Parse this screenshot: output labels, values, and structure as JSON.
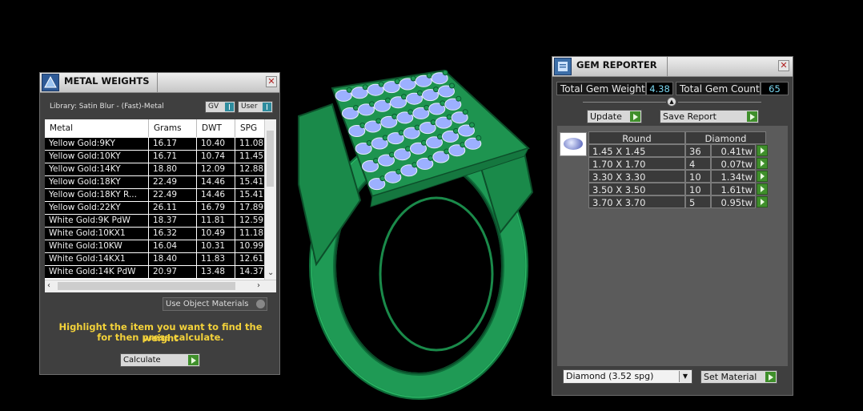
{
  "metal_weights": {
    "title": "METAL WEIGHTS",
    "library_label": "Library: Satin Blur - (Fast)-Metal",
    "toggles": [
      "GV",
      "User"
    ],
    "columns": [
      "Metal",
      "Grams",
      "DWT",
      "SPG"
    ],
    "rows": [
      [
        "Yellow Gold:9KY",
        "16.17",
        "10.40",
        "11.08"
      ],
      [
        "Yellow Gold:10KY",
        "16.71",
        "10.74",
        "11.45"
      ],
      [
        "Yellow Gold:14KY",
        "18.80",
        "12.09",
        "12.88"
      ],
      [
        "Yellow Gold:18KY",
        "22.49",
        "14.46",
        "15.41"
      ],
      [
        "Yellow Gold:18KY R...",
        "22.49",
        "14.46",
        "15.41"
      ],
      [
        "Yellow Gold:22KY",
        "26.11",
        "16.79",
        "17.89"
      ],
      [
        "White Gold:9K PdW",
        "18.37",
        "11.81",
        "12.59"
      ],
      [
        "White Gold:10KX1",
        "16.32",
        "10.49",
        "11.18"
      ],
      [
        "White Gold:10KW",
        "16.04",
        "10.31",
        "10.99"
      ],
      [
        "White Gold:14KX1",
        "18.40",
        "11.83",
        "12.61"
      ],
      [
        "White Gold:14K PdW",
        "20.97",
        "13.48",
        "14.37"
      ]
    ],
    "use_object_materials": "Use Object Materials",
    "hint_line1": "Highlight the item you want to find the weight",
    "hint_line2": "for then press calculate.",
    "calculate_label": "Calculate"
  },
  "gem_reporter": {
    "title": "GEM REPORTER",
    "total_weight_label": "Total Gem Weight",
    "total_weight_value": "4.38",
    "total_count_label": "Total Gem Count",
    "total_count_value": "65",
    "update_label": "Update",
    "save_report_label": "Save Report",
    "shape_header": "Round",
    "material_header": "Diamond",
    "gems": [
      [
        "1.45 X 1.45",
        "36",
        "0.41tw"
      ],
      [
        "1.70 X 1.70",
        "4",
        "0.07tw"
      ],
      [
        "3.30 X 3.30",
        "10",
        "1.34tw"
      ],
      [
        "3.50 X 3.50",
        "10",
        "1.61tw"
      ],
      [
        "3.70 X 3.70",
        "5",
        "0.95tw"
      ]
    ],
    "material_select": "Diamond      (3.52 spg)",
    "set_material_label": "Set Material"
  },
  "colors": {
    "ring_green": "#1f9a55",
    "hint_yellow": "#f2d13a",
    "value_cyan": "#7ad7f0"
  }
}
